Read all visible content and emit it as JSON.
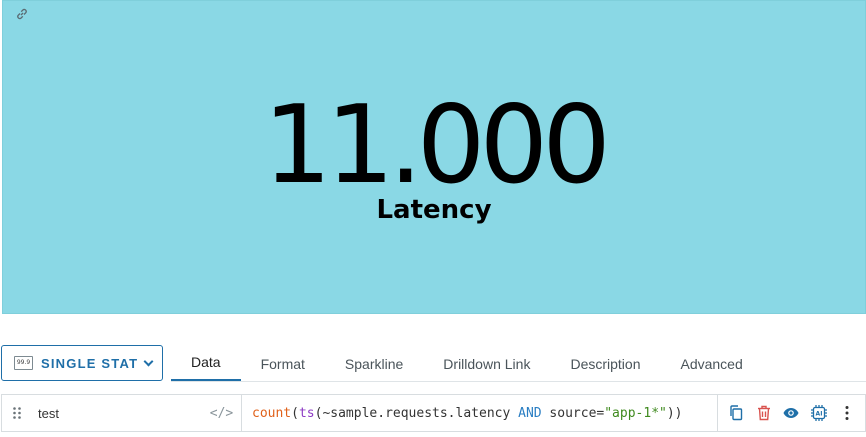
{
  "panel": {
    "value": "11.000",
    "label": "Latency",
    "background": "#8ad8e5"
  },
  "toolbar": {
    "chart_type_icon_text": "99.9",
    "chart_type_label": "SINGLE STAT"
  },
  "tabs": [
    {
      "label": "Data",
      "active": true
    },
    {
      "label": "Format",
      "active": false
    },
    {
      "label": "Sparkline",
      "active": false
    },
    {
      "label": "Drilldown Link",
      "active": false
    },
    {
      "label": "Description",
      "active": false
    },
    {
      "label": "Advanced",
      "active": false
    }
  ],
  "query": {
    "name": "test",
    "code_toggle": "</>",
    "tokens": {
      "fn_count": "count",
      "paren_open_1": "(",
      "fn_ts": "ts",
      "paren_open_2": "(",
      "metric": "~sample.requests.latency ",
      "keyword": "AND",
      "filter": " source=",
      "value": "\"app-1*\"",
      "close": "))"
    }
  },
  "icons": {
    "link": "link-icon",
    "copy": "copy-icon",
    "delete": "trash-icon",
    "visibility": "eye-icon",
    "ai": "ai-chip-icon",
    "more": "more-vertical-icon",
    "drag": "drag-handle-icon"
  },
  "colors": {
    "accent": "#1f6fa8",
    "delete": "#d9534f"
  }
}
